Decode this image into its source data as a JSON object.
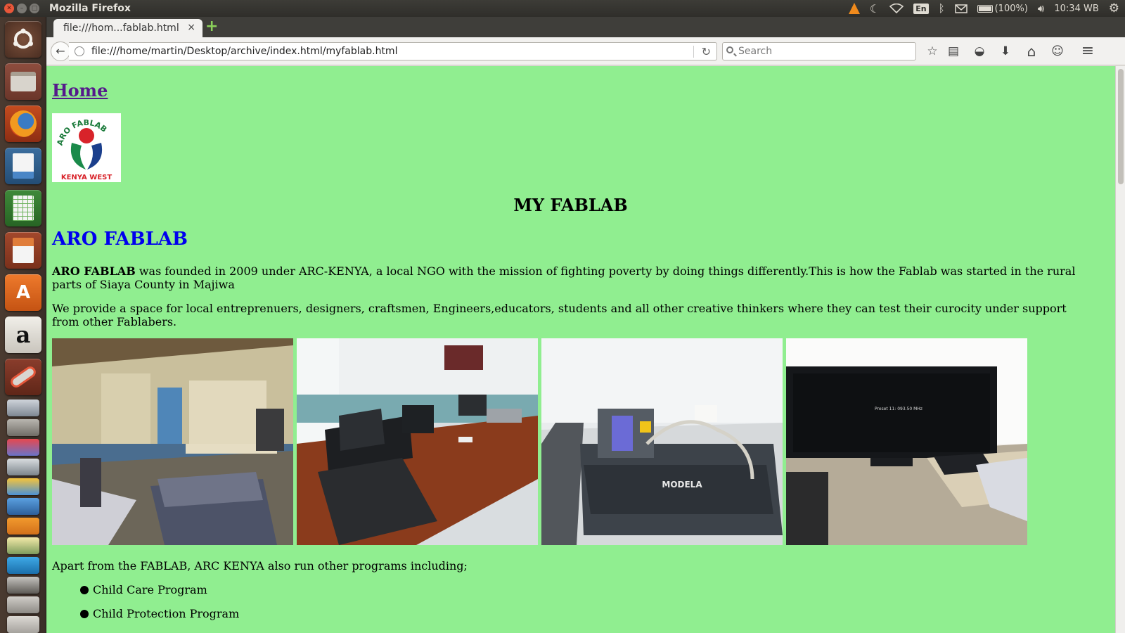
{
  "window": {
    "title": "Mozilla Firefox"
  },
  "system_tray": {
    "battery_text": "(100%)",
    "clock": "10:34 WB",
    "keyboard_layout": "En",
    "icons": [
      "vlc-icon",
      "night-mode-icon",
      "wifi-icon",
      "keyboard-layout-icon",
      "bluetooth-icon",
      "mail-icon",
      "battery-icon",
      "volume-icon",
      "settings-icon"
    ]
  },
  "launcher": {
    "items": [
      "ubuntu-dash-icon",
      "files-icon",
      "firefox-icon",
      "libreoffice-writer-icon",
      "libreoffice-calc-icon",
      "libreoffice-impress-icon",
      "software-center-icon",
      "amazon-icon",
      "system-settings-icon"
    ],
    "amazon_glyph": "a",
    "software_center_glyph": "A"
  },
  "browser": {
    "tab_title": "file:///hom...fablab.html",
    "tab_close": "×",
    "new_tab": "+",
    "url": "file:///home/martin/Desktop/archive/index.html/myfablab.html",
    "search_placeholder": "Search",
    "back_glyph": "←",
    "reload_glyph": "↻",
    "toolbar_glyphs": {
      "bookmark": "☆",
      "reading_list": "▤",
      "pocket": "◒",
      "download": "⬇",
      "home": "⌂",
      "chat": "☺",
      "menu": "≡"
    }
  },
  "page": {
    "home_link": "Home",
    "logo_text_top": "ARO FABLAB",
    "logo_text_bottom": "KENYA WEST",
    "title": "MY FABLAB",
    "heading": "ARO FABLAB",
    "para1_bold": "ARO FABLAB",
    "para1_rest": " was founded in 2009 under ARC-KENYA, a local NGO with the mission of fighting poverty by doing things differently.This is how the Fablab was started in the rural parts of Siaya County in Majiwa",
    "para2": "We provide a space for local entreprenuers, designers, craftsmen, Engineers,educators, students and all other creative thinkers where they can test their curocity under support from other Fablabers.",
    "para3": "Apart from the FABLAB, ARC KENYA also run other programs including;",
    "programs": [
      "Child Care Program",
      "Child Protection Program"
    ],
    "photos": [
      "photo-fablab-room",
      "photo-computer-desk",
      "photo-modela-machine",
      "photo-tv-screen"
    ],
    "photo_machine_label": "MODELA",
    "photo_tv_text": "Preset 11:  093.50 MHz"
  },
  "colors": {
    "page_background": "#90ee90",
    "link_visited": "#551a8b",
    "heading_blue": "#0000ee"
  }
}
